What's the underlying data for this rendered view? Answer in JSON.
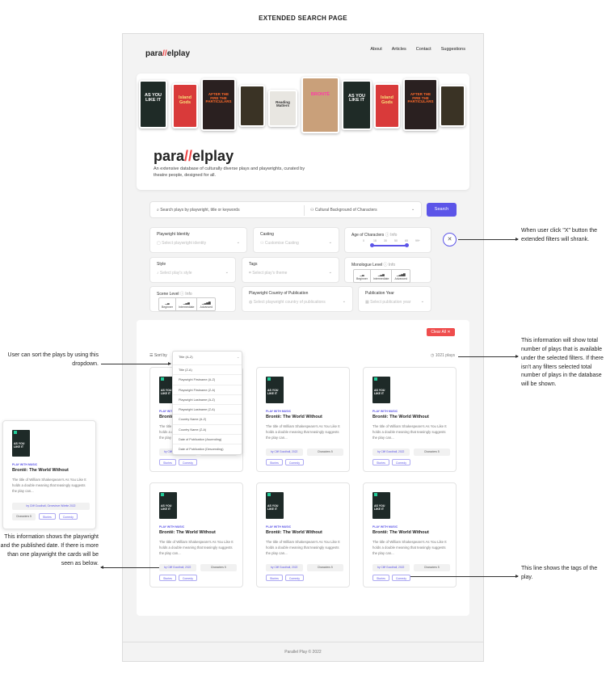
{
  "page_title": "EXTENDED SEARCH PAGE",
  "nav": {
    "logo_a": "para",
    "logo_b": "//",
    "logo_c": "elplay",
    "links": [
      "About",
      "Articles",
      "Contact",
      "Suggestions"
    ]
  },
  "hero": {
    "logo_a": "para",
    "logo_b": "//",
    "logo_c": "elplay",
    "description": "An extensive database of culturally diverse plays and playwrights, curated by theatre people, designed for all."
  },
  "search": {
    "placeholder": "Search plays by playwright, title or keywords",
    "select": "Cultural Background of Characters",
    "button": "Search"
  },
  "filters": {
    "playwright_identity": {
      "label": "Playwright Identity",
      "placeholder": "Select playwright identity"
    },
    "casting": {
      "label": "Casting",
      "placeholder": "Customise Casting"
    },
    "age": {
      "label": "Age of Characters",
      "info": "ⓘ Info",
      "ticks": [
        "0",
        "18",
        "30",
        "50",
        "65",
        "99+"
      ],
      "range": [
        18,
        65
      ]
    },
    "style": {
      "label": "Style",
      "placeholder": "Select play's style"
    },
    "tags": {
      "label": "Tags",
      "placeholder": "Select play's theme"
    },
    "monologue": {
      "label": "Monologue Level",
      "info": "ⓘ Info",
      "levels": [
        "Beginner",
        "Intermediate",
        "Advanced"
      ]
    },
    "scene": {
      "label": "Scene Level",
      "info": "ⓘ Info",
      "levels": [
        "Beginner",
        "Intermediate",
        "Advanced"
      ]
    },
    "country": {
      "label": "Playwright Country of Publication",
      "placeholder": "Select playwright country of publications"
    },
    "year": {
      "label": "Publication Year",
      "placeholder": "Select publication year"
    }
  },
  "results": {
    "clear": "Clear All ✕",
    "sort_label": "Sort by",
    "count": "1021 plays",
    "sort_selected": "Title (A-Z)",
    "sort_options": [
      "Title (Z-A)",
      "Playwright Firstname (A-Z)",
      "Playwright Firstname (Z-A)",
      "Playwright Lastname (A-Z)",
      "Playwright Lastname (Z-A)",
      "Country Name (A-Z)",
      "Country Name (Z-A)",
      "Date of Publication (Ascending)",
      "Date of Publication (Descending)"
    ]
  },
  "card": {
    "poster_text": "AS YOU LIKE IT",
    "category": "PLAY WITH MUSIC",
    "title": "Brontë: The World Without",
    "description": "The title of William Shakespeare's As You Like It holds a double meaning that teasingly suggests the play can...",
    "author": "by Cliff Goodhall, 2022",
    "characters": "Characters 5",
    "tags": [
      "Stories",
      "Comedy"
    ]
  },
  "example_card": {
    "author": "by Cliff Goodhall, Genevieve Wilette 2022",
    "characters": "Characters 5",
    "tags": [
      "Stories",
      "Comedy"
    ]
  },
  "posters": [
    {
      "text": "AS YOU LIKE IT",
      "bg": "#1f2b27",
      "fg": "#ffffff"
    },
    {
      "text": "Island Gods",
      "bg": "#d93a3a",
      "fg": "#f6e07a"
    },
    {
      "text": "AFTER THE FIRE THE PARTICULARS",
      "bg": "#2a2020",
      "fg": "#ff6a2a"
    },
    {
      "text": "",
      "bg": "#3a3325",
      "fg": "#d6b25a"
    },
    {
      "text": "Reading Matters",
      "bg": "#e8e6e1",
      "fg": "#333333"
    },
    {
      "text": "BRONTË",
      "bg": "#c9a07a",
      "fg": "#ff3aa6"
    },
    {
      "text": "AS YOU LIKE IT",
      "bg": "#1f2b27",
      "fg": "#ffffff"
    },
    {
      "text": "Island Gods",
      "bg": "#d93a3a",
      "fg": "#f6e07a"
    },
    {
      "text": "AFTER THE FIRE THE PARTICULARS",
      "bg": "#2a2020",
      "fg": "#ff6a2a"
    },
    {
      "text": "",
      "bg": "#3a3325",
      "fg": "#d6b25a"
    }
  ],
  "annotations": {
    "close": "When user click \"X\" button the extended filters will shrank.",
    "count": "This information will show total number of plays that is available under the selected filters. If there isn't any filters selected total number of plays in the database will be shown.",
    "sort": "User can sort the plays by using this dropdown.",
    "author": "This information shows the playwright and the published date. If there is more than one playwright the cards will be seen as below.",
    "tags": "This line shows the tags of the play."
  },
  "footer": "Parallel Play © 2022",
  "colors": {
    "accent": "#5c55e8",
    "danger": "#ef4d4d"
  }
}
